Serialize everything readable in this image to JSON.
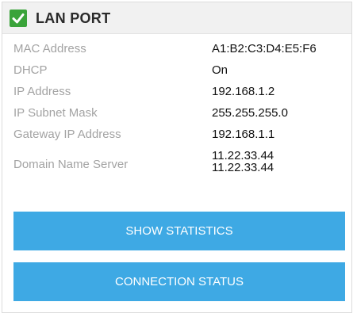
{
  "header": {
    "title": "LAN PORT"
  },
  "fields": [
    {
      "label": "MAC Address",
      "value": "A1:B2:C3:D4:E5:F6"
    },
    {
      "label": "DHCP",
      "value": "On"
    },
    {
      "label": "IP Address",
      "value": "192.168.1.2"
    },
    {
      "label": "IP Subnet Mask",
      "value": "255.255.255.0"
    },
    {
      "label": "Gateway IP Address",
      "value": "192.168.1.1"
    }
  ],
  "dns": {
    "label": "Domain Name Server",
    "values": [
      "11.22.33.44",
      "11.22.33.44"
    ]
  },
  "buttons": {
    "show_statistics": "SHOW STATISTICS",
    "connection_status": "CONNECTION STATUS"
  },
  "colors": {
    "accent": "#3ea9e4",
    "status_ok": "#3aa33a"
  },
  "icons": {
    "status": "checkmark-icon"
  }
}
